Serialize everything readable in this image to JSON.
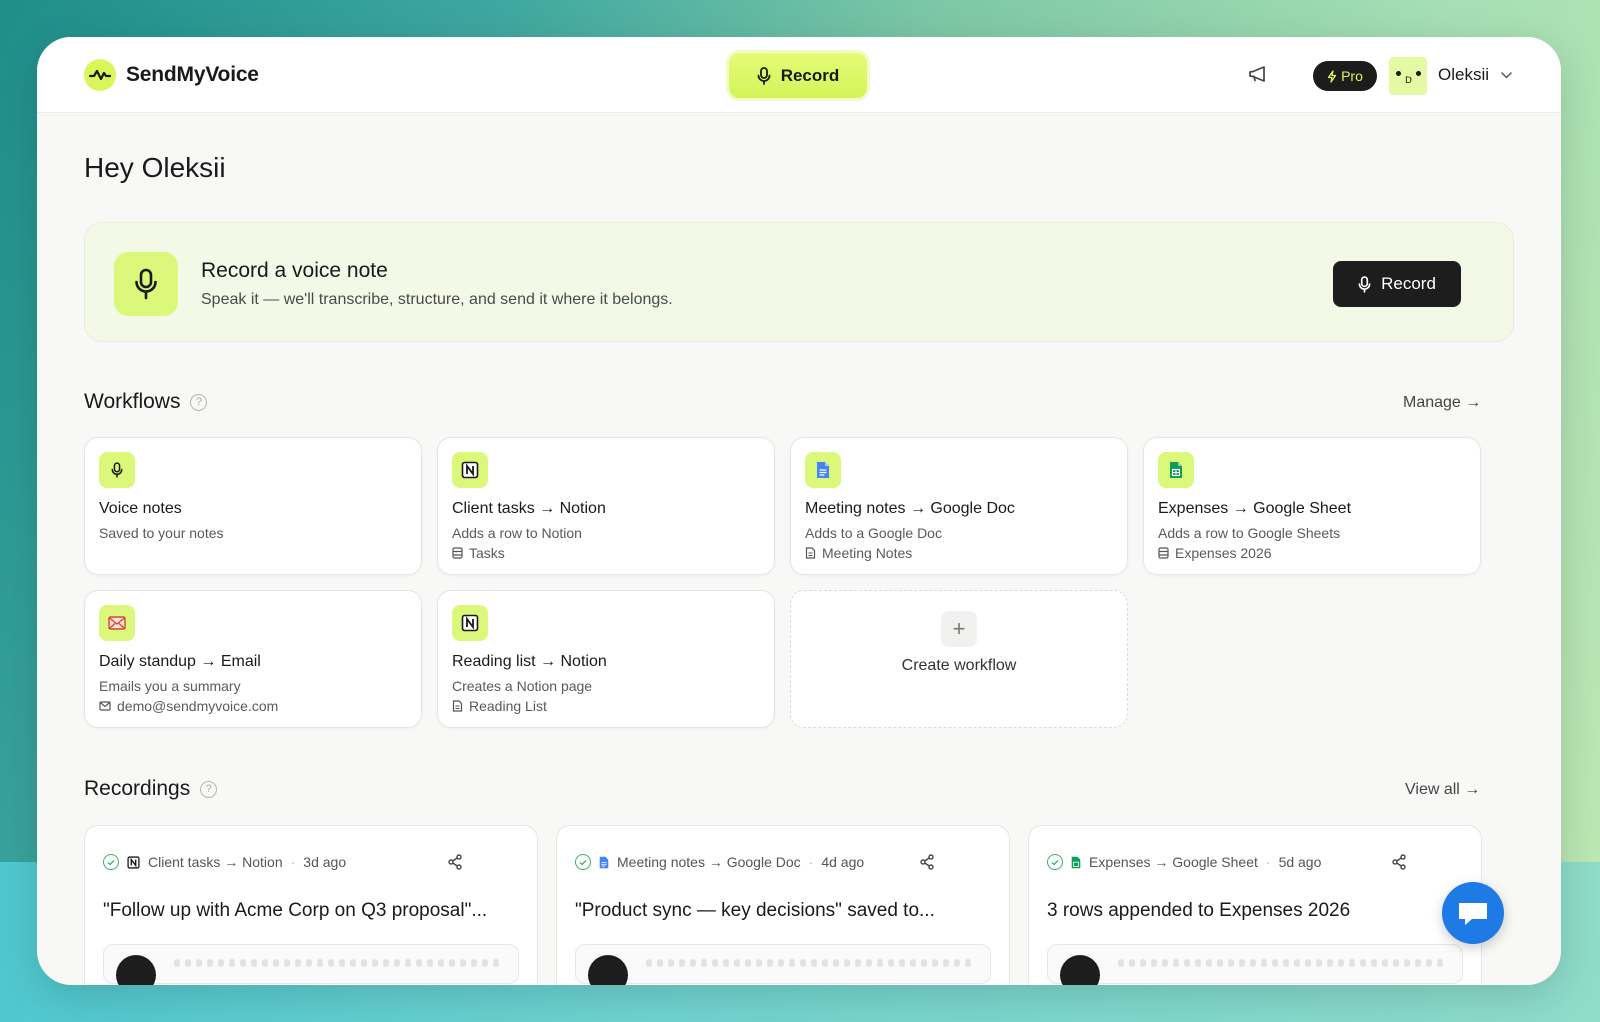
{
  "app": {
    "name": "SendMyVoice"
  },
  "header": {
    "record_label": "Record",
    "plan_badge": "Pro",
    "user_name": "Oleksii",
    "avatar_initial": "D"
  },
  "greeting": "Hey Oleksii",
  "hero": {
    "title": "Record a voice note",
    "subtitle": "Speak it — we'll transcribe, structure, and send it where it belongs.",
    "button_label": "Record"
  },
  "workflows": {
    "title": "Workflows",
    "help": "?",
    "manage_label": "Manage →",
    "items": [
      {
        "title": "Voice notes",
        "subtitle": "Saved to your notes",
        "detail": "",
        "icon": "mic-icon"
      },
      {
        "title": "Client tasks → Notion",
        "subtitle": "Adds a row to Notion",
        "detail": "Tasks",
        "icon": "notion-icon"
      },
      {
        "title": "Meeting notes → Google Doc",
        "subtitle": "Adds to a Google Doc",
        "detail": "Meeting Notes",
        "icon": "google-doc-icon"
      },
      {
        "title": "Expenses → Google Sheet",
        "subtitle": "Adds a row to Google Sheets",
        "detail": "Expenses 2026",
        "icon": "google-sheet-icon"
      },
      {
        "title": "Daily standup → Email",
        "subtitle": "Emails you a summary",
        "detail": "demo@sendmyvoice.com",
        "icon": "email-icon"
      },
      {
        "title": "Reading list → Notion",
        "subtitle": "Creates a Notion page",
        "detail": "Reading List",
        "icon": "notion-icon"
      }
    ],
    "create_label": "Create workflow"
  },
  "recordings": {
    "title": "Recordings",
    "help": "?",
    "view_all_label": "View all →",
    "items": [
      {
        "workflow": "Client tasks → Notion",
        "time": "3d ago",
        "summary": "\"Follow up with Acme Corp on Q3 proposal\"..."
      },
      {
        "workflow": "Meeting notes → Google Doc",
        "time": "4d ago",
        "summary": "\"Product sync — key decisions\" saved to..."
      },
      {
        "workflow": "Expenses → Google Sheet",
        "time": "5d ago",
        "summary": "3 rows appended to Expenses 2026"
      }
    ]
  },
  "colors": {
    "accent": "#dcf87a",
    "dark": "#1d1d1d",
    "chat": "#1e7be6"
  }
}
